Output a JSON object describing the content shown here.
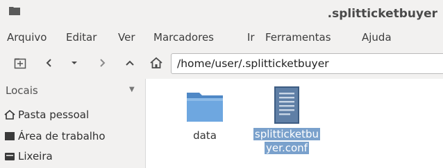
{
  "window": {
    "title": ".splitticketbuyer"
  },
  "menu": [
    "Arquivo",
    "Editar",
    "Ver",
    "Marcadores",
    "Ir",
    "Ferramentas",
    "Ajuda"
  ],
  "location": {
    "path": "/home/user/.splitticketbuyer"
  },
  "sidebar": {
    "header": "Locais",
    "items": [
      {
        "label": "Pasta pessoal",
        "icon": "home-icon"
      },
      {
        "label": "Área de trabalho",
        "icon": "desktop-icon"
      },
      {
        "label": "Lixeira",
        "icon": "trash-icon"
      }
    ]
  },
  "files": [
    {
      "name": "data",
      "type": "folder",
      "selected": false
    },
    {
      "name_line1": "splitticketbu",
      "name_line2": "yer.conf",
      "type": "text-file",
      "selected": true
    }
  ],
  "colors": {
    "chrome": "#f2f1f0",
    "selection": "#7aa1cc",
    "folder": "#5b97d6"
  }
}
